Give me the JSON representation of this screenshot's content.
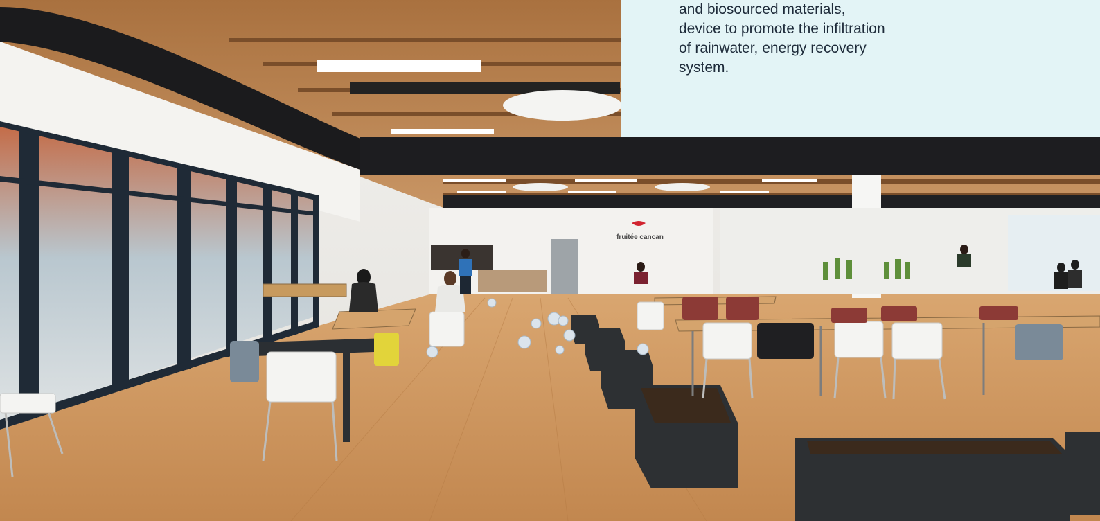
{
  "info_panel": {
    "lines": [
      "and biosourced materials,",
      "device to promote the infiltration",
      "of rainwater, energy recovery",
      "system."
    ]
  },
  "photo": {
    "wall_sign_text": "fruitée cancan"
  },
  "colors": {
    "panel_background": "#e3f4f6",
    "panel_text": "#1e2b3a",
    "floor": "#c8935c",
    "ceiling_wood": "#b98452",
    "duct": "#1b1b1d",
    "planter": "#2d3033"
  }
}
